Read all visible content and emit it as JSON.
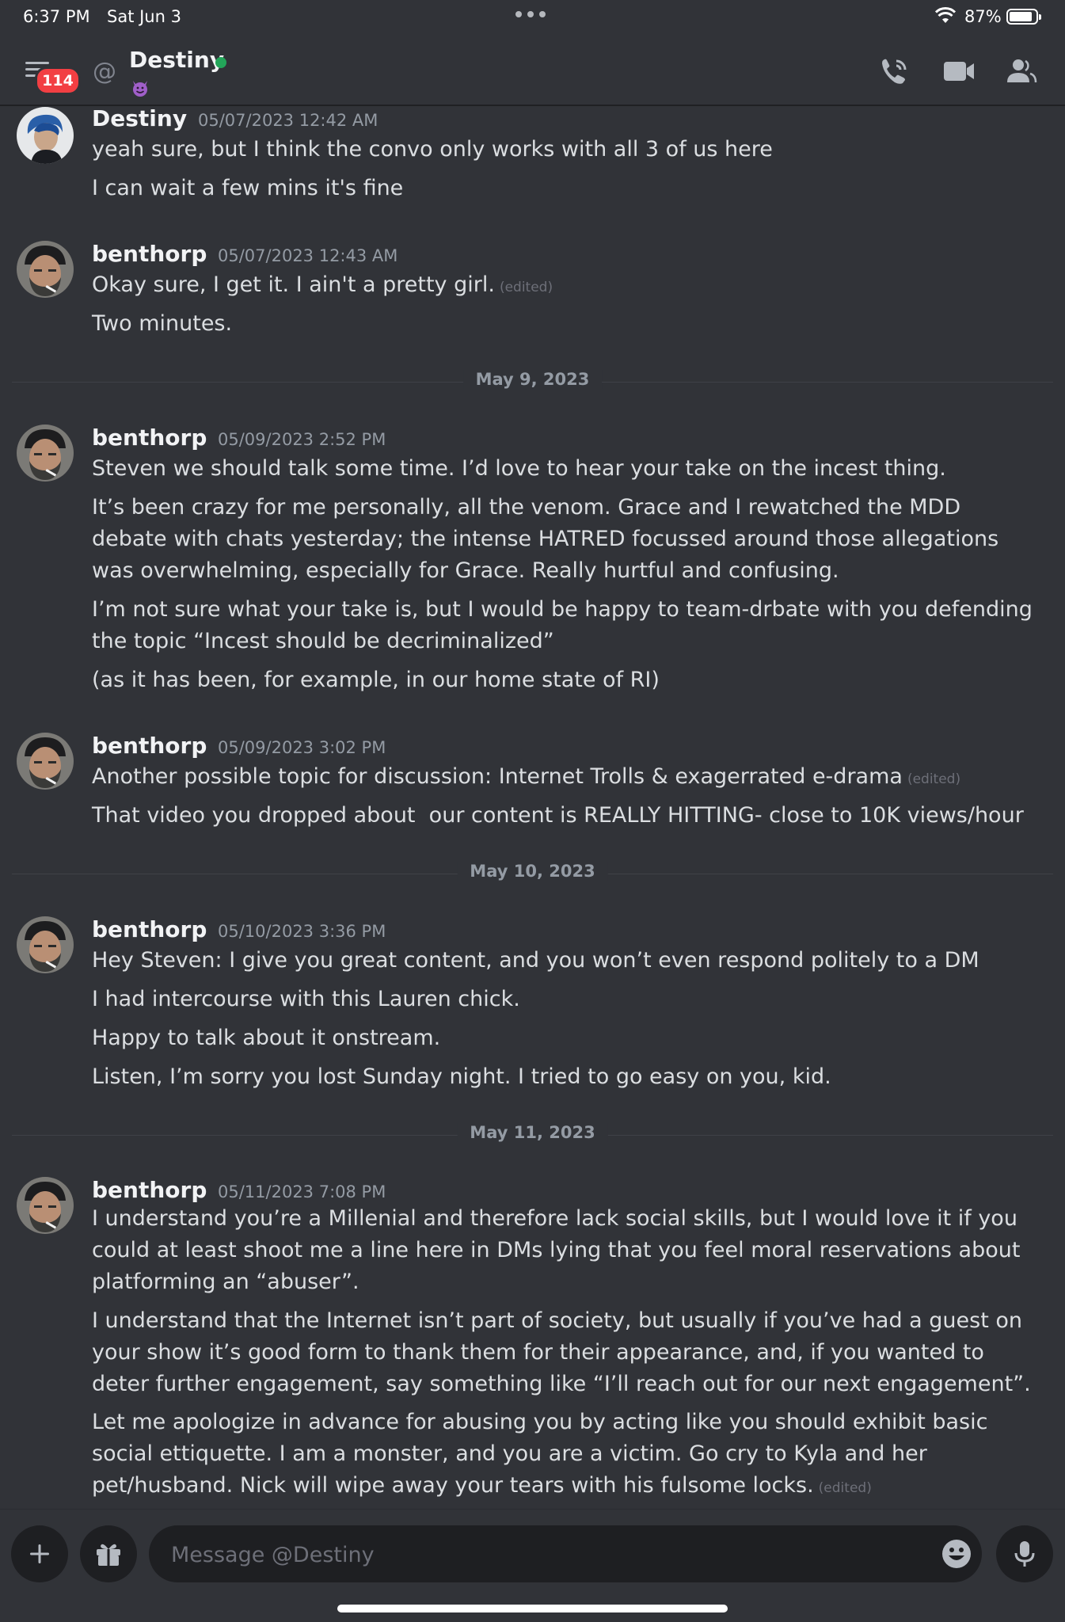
{
  "status_bar": {
    "time": "6:37 PM",
    "date": "Sat Jun 3",
    "battery": "87%",
    "battery_level": 0.87
  },
  "header": {
    "unread_badge": "114",
    "channel_name": "Destiny",
    "status": "online",
    "status_emoji": "smiling-devil-emoji",
    "icons": [
      "menu-icon",
      "at-icon",
      "call-icon",
      "video-icon",
      "members-icon"
    ]
  },
  "messages": [
    {
      "author": "Destiny",
      "timestamp": "05/07/2023 12:42 AM",
      "avatar": "destiny-avatar",
      "lines": [
        {
          "text": "yeah sure, but I think the convo only works with all 3 of us here",
          "edited": ""
        },
        {
          "text": "I can wait a few mins it's fine",
          "edited": ""
        }
      ]
    },
    {
      "author": "benthorp",
      "timestamp": "05/07/2023 12:43 AM",
      "avatar": "benthorp-avatar",
      "lines": [
        {
          "text": "Okay sure, I get it. I ain't a pretty girl.",
          "edited": "(edited)"
        },
        {
          "text": "Two minutes.",
          "edited": ""
        }
      ]
    },
    {
      "author": "benthorp",
      "timestamp": "05/09/2023 2:52 PM",
      "avatar": "benthorp-avatar",
      "lines": [
        {
          "text": "Steven we should talk some time. I’d love to hear your take on the incest thing.",
          "edited": ""
        },
        {
          "text": "It’s been crazy for me personally, all the venom. Grace and I rewatched the MDD debate with chats yesterday; the intense HATRED focussed around those allegations was overwhelming, especially for Grace. Really hurtful and confusing.",
          "edited": ""
        },
        {
          "text": "I’m not sure what your take is, but I would be happy to team-drbate with you defending the topic “Incest should be decriminalized”",
          "edited": ""
        },
        {
          "text": "(as it has been, for example, in our home state of RI)",
          "edited": ""
        }
      ]
    },
    {
      "author": "benthorp",
      "timestamp": "05/09/2023 3:02 PM",
      "avatar": "benthorp-avatar",
      "lines": [
        {
          "text": "Another possible topic for discussion: Internet Trolls & exagerrated e-drama",
          "edited": "(edited)"
        },
        {
          "text": "That video you dropped about  our content is REALLY HITTING- close to 10K views/hour",
          "edited": ""
        }
      ]
    },
    {
      "author": "benthorp",
      "timestamp": "05/10/2023 3:36 PM",
      "avatar": "benthorp-avatar",
      "lines": [
        {
          "text": "Hey Steven: I give you great content, and you won’t even respond politely to a DM",
          "edited": ""
        },
        {
          "text": "I had intercourse with this Lauren chick.",
          "edited": ""
        },
        {
          "text": "Happy to talk about it onstream.",
          "edited": ""
        },
        {
          "text": "Listen, I’m sorry you lost Sunday night. I tried to go easy on you, kid.",
          "edited": ""
        }
      ]
    },
    {
      "author": "benthorp",
      "timestamp": "05/11/2023 7:08 PM",
      "avatar": "benthorp-avatar",
      "lines": [
        {
          "text": "I understand you’re a Millenial and therefore lack social skills, but I would love it if you could at least shoot me a line here in DMs lying that you feel moral reservations about platforming an “abuser”.",
          "edited": ""
        },
        {
          "text": "I understand that the Internet isn’t part of society, but usually if you’ve had a guest on your show it’s good form to thank them for their appearance, and, if you wanted to deter further engagement, say something like “I’ll reach out for our next engagement”.",
          "edited": ""
        },
        {
          "text": "Let me apologize in advance for abusing you by acting like you should exhibit basic social ettiquette. I am a monster, and you are a victim. Go cry to Kyla and her pet/husband. Nick will wipe away your tears with his fulsome locks.",
          "edited": "(edited)"
        }
      ]
    }
  ],
  "date_dividers": [
    "May 9, 2023",
    "May 10, 2023",
    "May 11, 2023"
  ],
  "composer": {
    "placeholder": "Message @Destiny",
    "value": "",
    "icons": [
      "plus-icon",
      "gift-icon",
      "emoji-icon",
      "microphone-icon"
    ]
  },
  "colors": {
    "background": "#313338",
    "input_background": "#1e1f22",
    "badge": "#f23f43",
    "online": "#23a559",
    "muted_text": "#949ba4"
  }
}
